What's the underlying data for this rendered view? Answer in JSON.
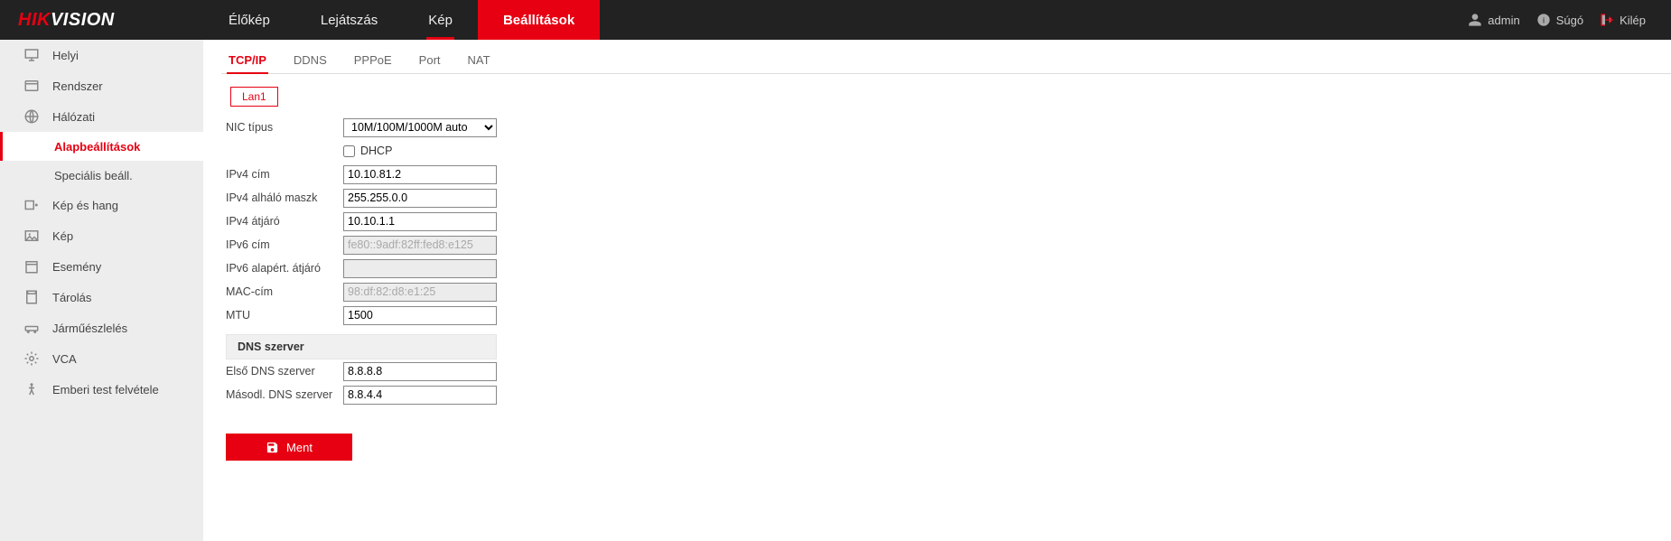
{
  "brand": {
    "part1": "HIK",
    "part2": "VISION"
  },
  "mainnav": [
    {
      "label": "Élőkép",
      "active": false
    },
    {
      "label": "Lejátszás",
      "active": false
    },
    {
      "label": "Kép",
      "active": false,
      "underline": true
    },
    {
      "label": "Beállítások",
      "active": true
    }
  ],
  "topright": {
    "user": "admin",
    "help": "Súgó",
    "logout": "Kilép"
  },
  "sidebar": [
    {
      "label": "Helyi",
      "icon": "monitor"
    },
    {
      "label": "Rendszer",
      "icon": "system"
    },
    {
      "label": "Hálózati",
      "icon": "globe",
      "children": [
        {
          "label": "Alapbeállítások",
          "active": true
        },
        {
          "label": "Speciális beáll.",
          "active": false
        }
      ]
    },
    {
      "label": "Kép és hang",
      "icon": "av"
    },
    {
      "label": "Kép",
      "icon": "image"
    },
    {
      "label": "Esemény",
      "icon": "event"
    },
    {
      "label": "Tárolás",
      "icon": "storage"
    },
    {
      "label": "Járműészlelés",
      "icon": "vehicle"
    },
    {
      "label": "VCA",
      "icon": "vca"
    },
    {
      "label": "Emberi test felvétele",
      "icon": "body"
    }
  ],
  "subtabs": [
    {
      "label": "TCP/IP",
      "active": true
    },
    {
      "label": "DDNS"
    },
    {
      "label": "PPPoE"
    },
    {
      "label": "Port"
    },
    {
      "label": "NAT"
    }
  ],
  "lan_badge": "Lan1",
  "form": {
    "nic_type_label": "NIC típus",
    "nic_type_value": "10M/100M/1000M auto",
    "dhcp_label": "DHCP",
    "dhcp_checked": false,
    "ipv4_addr_label": "IPv4 cím",
    "ipv4_addr_value": "10.10.81.2",
    "ipv4_mask_label": "IPv4 alháló maszk",
    "ipv4_mask_value": "255.255.0.0",
    "ipv4_gw_label": "IPv4 átjáró",
    "ipv4_gw_value": "10.10.1.1",
    "ipv6_addr_label": "IPv6 cím",
    "ipv6_addr_value": "fe80::9adf:82ff:fed8:e125",
    "ipv6_gw_label": "IPv6 alapért. átjáró",
    "ipv6_gw_value": "",
    "mac_label": "MAC-cím",
    "mac_value": "98:df:82:d8:e1:25",
    "mtu_label": "MTU",
    "mtu_value": "1500",
    "dns_section": "DNS szerver",
    "dns1_label": "Első DNS szerver",
    "dns1_value": "8.8.8.8",
    "dns2_label": "Másodl. DNS szerver",
    "dns2_value": "8.8.4.4"
  },
  "save_label": "Ment"
}
